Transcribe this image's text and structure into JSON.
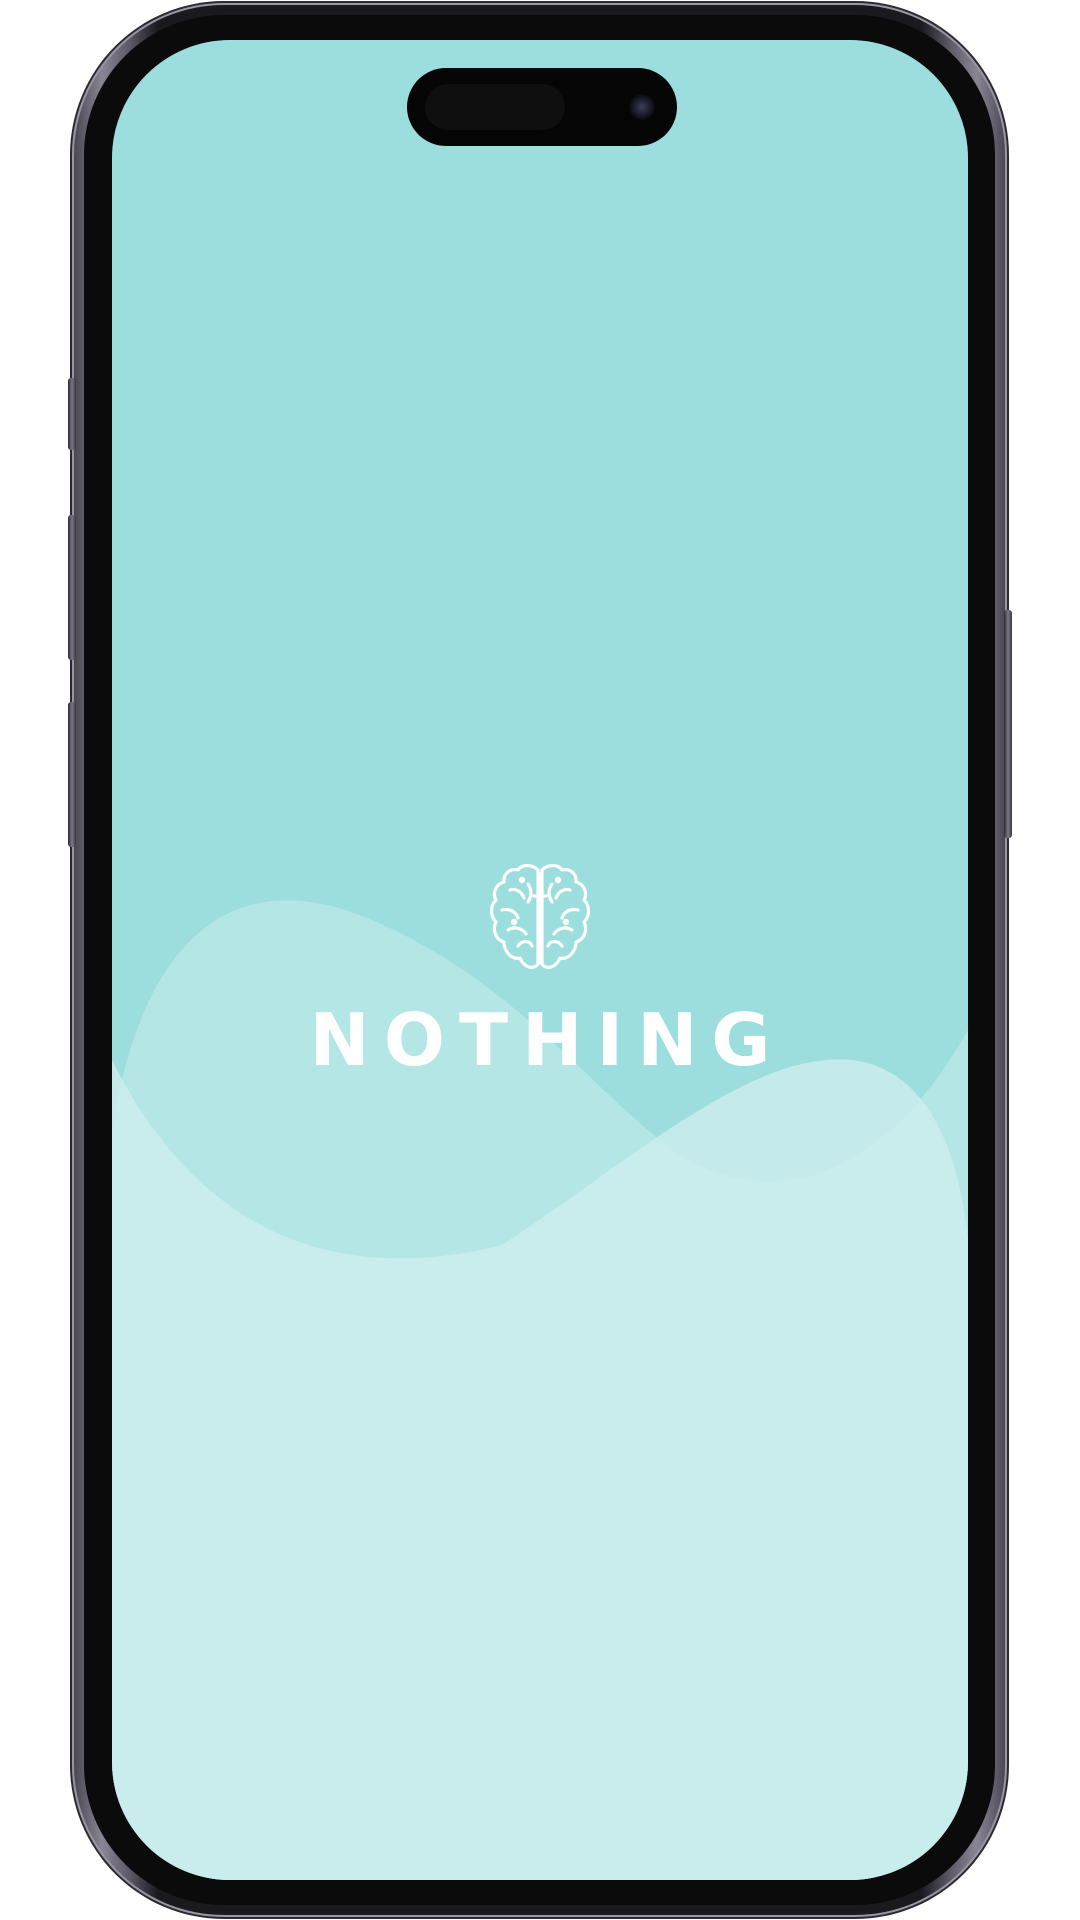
{
  "app": {
    "brand_name": "NOTHING",
    "logo_icon": "brain-icon"
  },
  "colors": {
    "background": "#9cdedd",
    "wave_light": "#b9e7e7",
    "wave_lighter": "#cdeced",
    "logo": "#ffffff"
  }
}
